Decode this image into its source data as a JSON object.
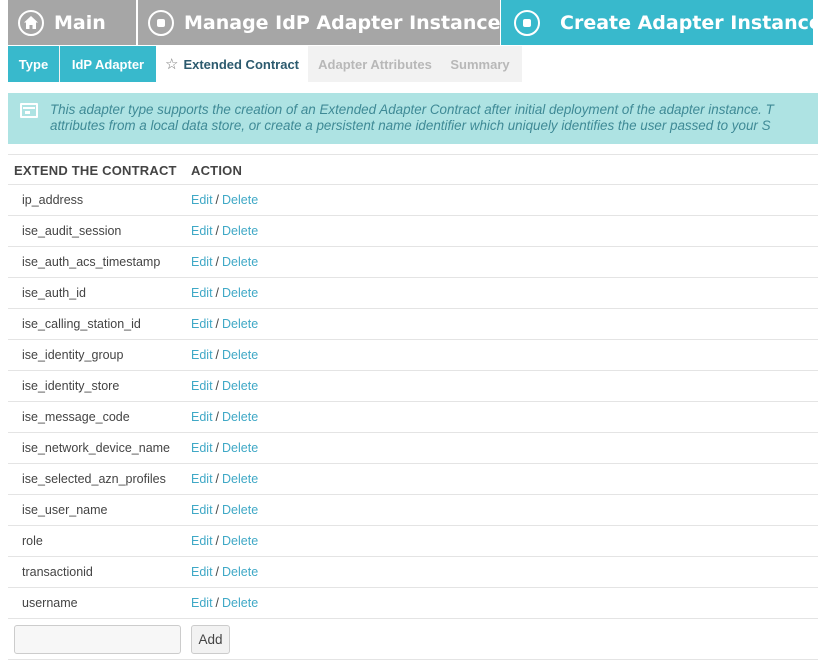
{
  "breadcrumbs": [
    {
      "label": "Main",
      "icon": "home-icon"
    },
    {
      "label": "Manage IdP Adapter Instances",
      "icon": "stop-circle-icon"
    },
    {
      "label": "Create Adapter Instance",
      "icon": "stop-circle-icon"
    }
  ],
  "tabs": [
    {
      "label": "Type",
      "state": "done"
    },
    {
      "label": "IdP Adapter",
      "state": "done"
    },
    {
      "label": "Extended Contract",
      "state": "active",
      "icon": "star-icon"
    },
    {
      "label": "Adapter Attributes",
      "state": "pending"
    },
    {
      "label": "Summary",
      "state": "pending"
    }
  ],
  "info": {
    "icon": "message-icon",
    "line1": "This adapter type supports the creation of an Extended Adapter Contract after initial deployment of the adapter instance. T",
    "line2": "attributes from a local data store, or create a persistent name identifier which uniquely identifies the user passed to your S"
  },
  "table": {
    "headers": {
      "attribute": "EXTEND THE CONTRACT",
      "action": "ACTION"
    },
    "edit_label": "Edit",
    "separator": "/",
    "delete_label": "Delete",
    "rows": [
      "ip_address",
      "ise_audit_session",
      "ise_auth_acs_timestamp",
      "ise_auth_id",
      "ise_calling_station_id",
      "ise_identity_group",
      "ise_identity_store",
      "ise_message_code",
      "ise_network_device_name",
      "ise_selected_azn_profiles",
      "ise_user_name",
      "role",
      "transactionid",
      "username"
    ]
  },
  "add": {
    "input_value": "",
    "button_label": "Add"
  },
  "colors": {
    "accent": "#38b9cc",
    "crumb_inactive": "#a6a6a6",
    "link": "#3fa8c6",
    "info_bg": "#aee3e3"
  }
}
